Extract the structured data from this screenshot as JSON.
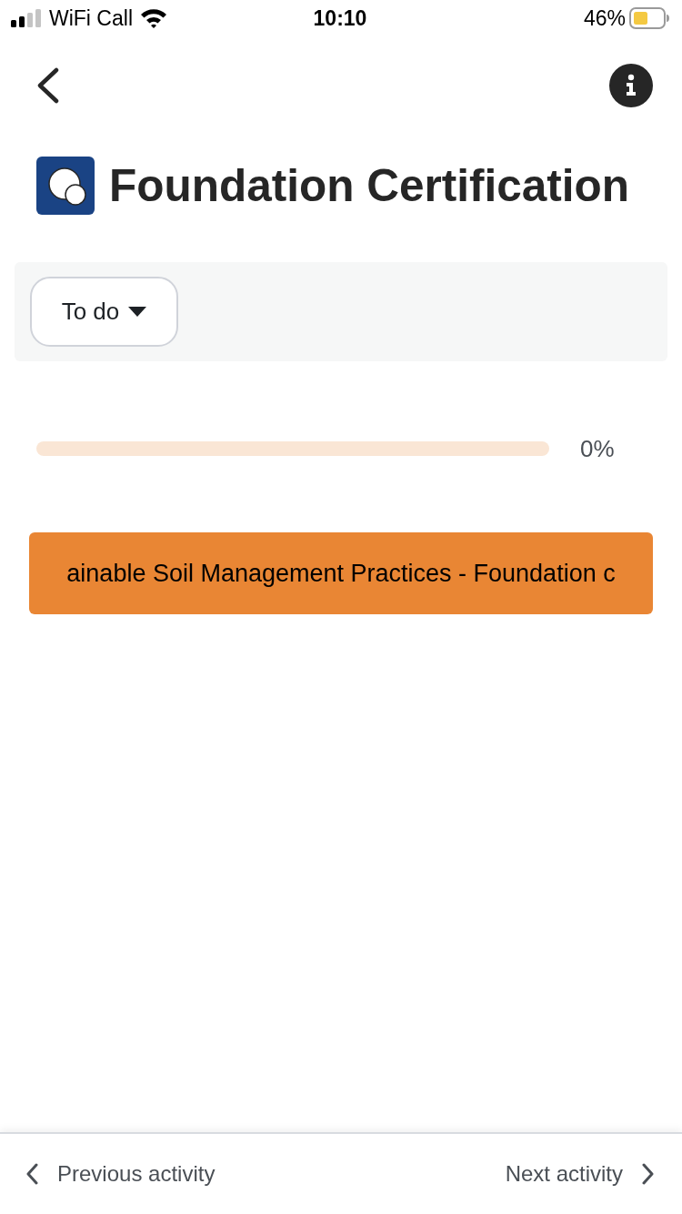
{
  "status_bar": {
    "carrier": "WiFi Call",
    "time": "10:10",
    "battery": "46%"
  },
  "header": {
    "title": "Foundation Certification"
  },
  "filter": {
    "label": "To do"
  },
  "progress": {
    "reading": "0%"
  },
  "activity": {
    "title": "ainable Soil Management Practices - Foundation c"
  },
  "footer": {
    "previous": "Previous activity",
    "next": "Next activity"
  }
}
